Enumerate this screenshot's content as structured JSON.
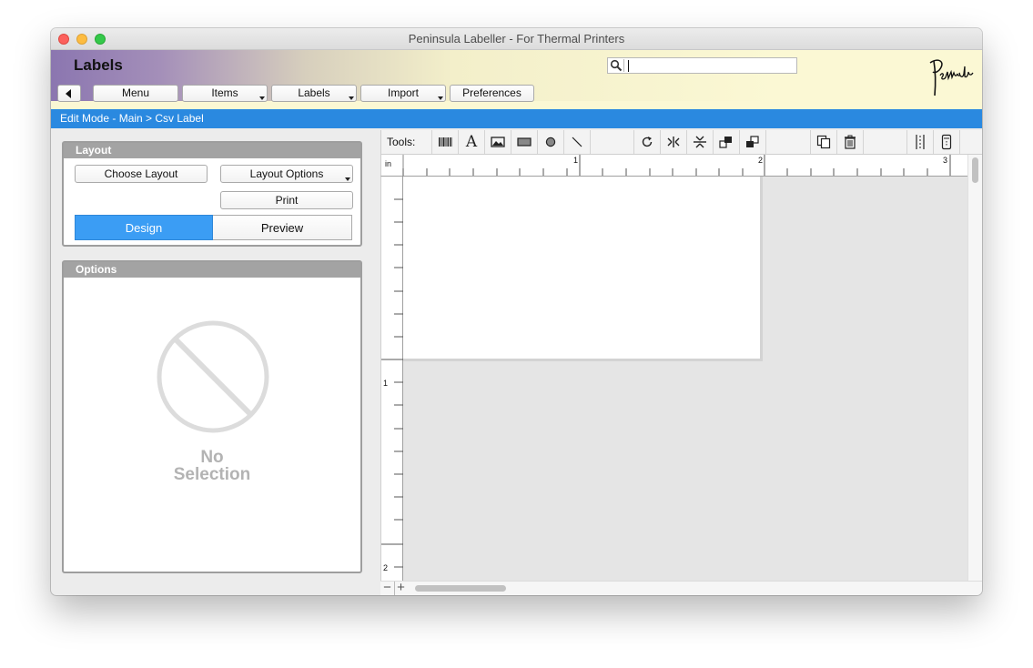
{
  "window": {
    "title": "Peninsula Labeller - For Thermal Printers"
  },
  "header": {
    "app_title": "Labels",
    "search": {
      "value": "",
      "placeholder": ""
    },
    "logo_text": "Peninsula"
  },
  "nav": {
    "back_icon": "back-arrow-icon",
    "buttons": [
      {
        "label": "Menu",
        "dropdown": false
      },
      {
        "label": "Items",
        "dropdown": true
      },
      {
        "label": "Labels",
        "dropdown": true
      },
      {
        "label": "Import",
        "dropdown": true
      },
      {
        "label": "Preferences",
        "dropdown": false
      }
    ]
  },
  "mode_bar": {
    "text": "Edit Mode - Main > Csv Label"
  },
  "layout_panel": {
    "title": "Layout",
    "choose_layout": "Choose Layout",
    "layout_options": "Layout Options",
    "print": "Print",
    "tabs": [
      {
        "label": "Design",
        "selected": true
      },
      {
        "label": "Preview",
        "selected": false
      }
    ]
  },
  "options_panel": {
    "title": "Options",
    "empty_line1": "No",
    "empty_line2": "Selection"
  },
  "toolbar": {
    "label": "Tools:",
    "tools": [
      "barcode-icon",
      "text-icon",
      "image-icon",
      "rectangle-icon",
      "ellipse-icon",
      "line-icon",
      "rotate-icon",
      "flip-horizontal-icon",
      "flip-vertical-icon",
      "bring-to-front-icon",
      "send-to-back-icon",
      "duplicate-icon",
      "trash-icon",
      "guides-icon",
      "label-size-icon"
    ]
  },
  "ruler": {
    "unit": "in",
    "top_labels": [
      "1",
      "2",
      "3"
    ],
    "left_labels": [
      "1",
      "2"
    ]
  },
  "zoom": {
    "minus": "−",
    "plus": "+"
  },
  "colors": {
    "accent_blue": "#2a89e0",
    "header_yellow": "#fbf8d4",
    "header_purple": "#8b76b0",
    "design_selected": "#3b9df4"
  }
}
